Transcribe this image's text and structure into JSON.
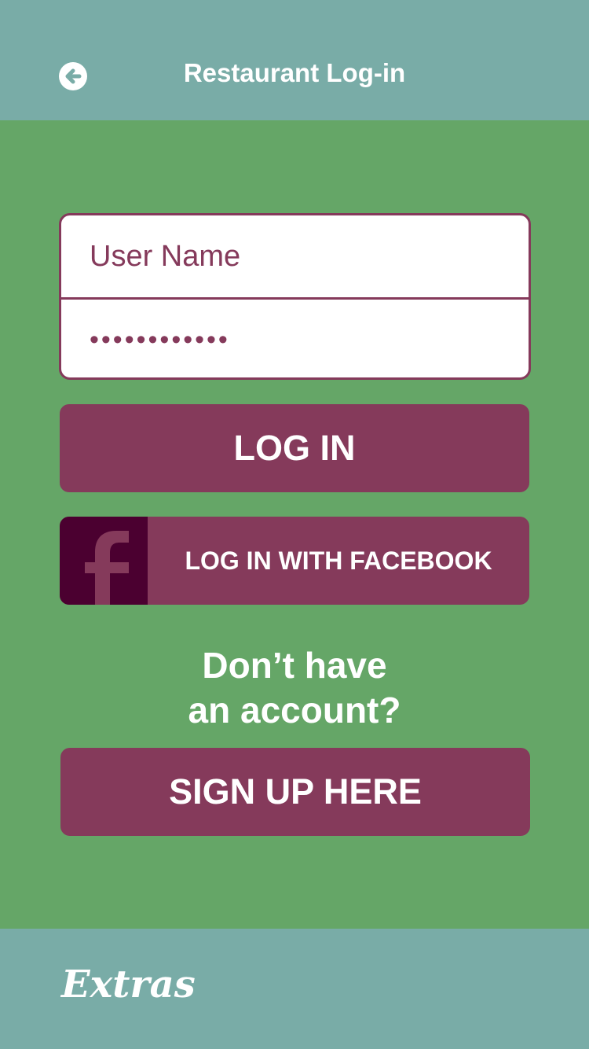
{
  "header": {
    "title": "Restaurant Log-in",
    "back_icon": "arrow-left-circle-icon"
  },
  "login_form": {
    "username_placeholder": "User Name",
    "password_value": "••••••••••••"
  },
  "buttons": {
    "login_label": "LOG IN",
    "facebook_label": "LOG IN WITH FACEBOOK",
    "facebook_icon": "facebook-f-icon",
    "signup_label": "SIGN UP HERE"
  },
  "signup_prompt": {
    "line1": "Don’t have",
    "line2": "an account?"
  },
  "footer": {
    "brand": "Extras"
  },
  "colors": {
    "bar_background": "#79aca7",
    "page_background": "#65a667",
    "button": "#853a5b",
    "facebook_icon_bg": "#4b0030",
    "text_light": "#ffffff"
  }
}
